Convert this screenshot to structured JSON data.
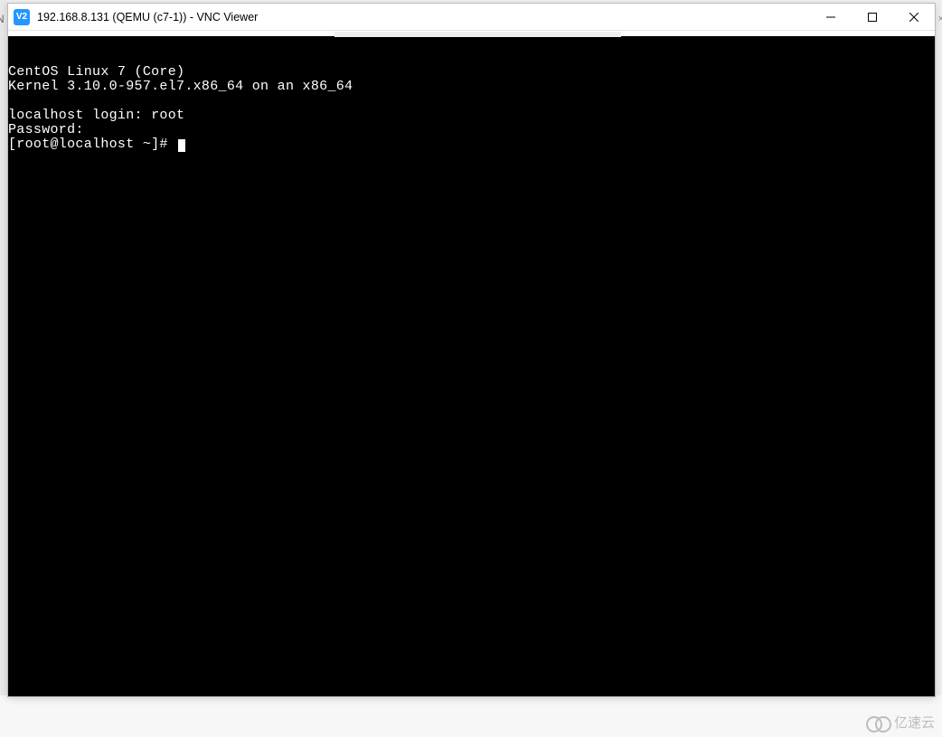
{
  "window": {
    "app_icon_text": "V2",
    "title": "192.168.8.131 (QEMU (c7-1)) - VNC Viewer"
  },
  "terminal": {
    "lines": [
      "CentOS Linux 7 (Core)",
      "Kernel 3.10.0-957.el7.x86_64 on an x86_64",
      "",
      "localhost login: root",
      "Password:",
      "[root@localhost ~]# "
    ]
  },
  "watermark": {
    "text": "亿速云"
  },
  "bg": {
    "left_fragment": "N",
    "right_fragment": "×"
  }
}
